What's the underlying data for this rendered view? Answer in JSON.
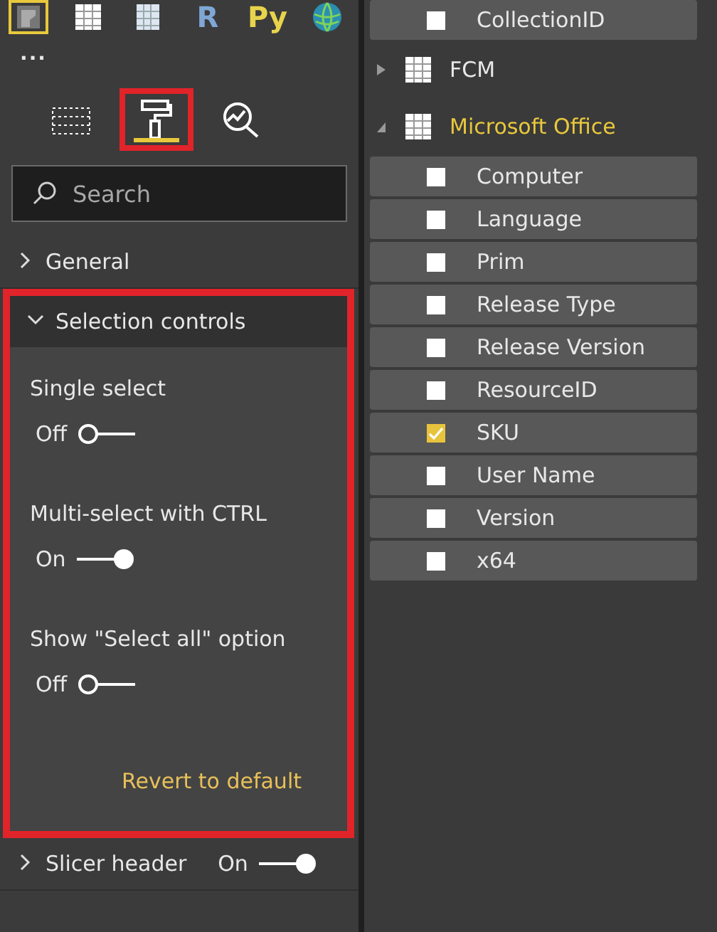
{
  "visual_icons": [
    {
      "kind": "slicer",
      "selected": true
    },
    {
      "kind": "table",
      "selected": false
    },
    {
      "kind": "matrix",
      "selected": false
    },
    {
      "kind": "r",
      "label": "R",
      "selected": false
    },
    {
      "kind": "python",
      "label": "Py",
      "selected": false
    },
    {
      "kind": "globe",
      "selected": false
    }
  ],
  "more_label": "...",
  "pane_tabs": [
    {
      "kind": "fields",
      "selected": false,
      "highlighted": false
    },
    {
      "kind": "format",
      "selected": true,
      "highlighted": true
    },
    {
      "kind": "analytics",
      "selected": false,
      "highlighted": false
    }
  ],
  "search": {
    "placeholder": "Search"
  },
  "sections": [
    {
      "title": "General",
      "expanded": false,
      "highlighted": false
    },
    {
      "title": "Selection controls",
      "expanded": true,
      "highlighted": true,
      "settings": [
        {
          "label": "Single select",
          "on": false,
          "reading": "Off"
        },
        {
          "label": "Multi-select with CTRL",
          "on": true,
          "reading": "On"
        },
        {
          "label": "Show \"Select all\" option",
          "on": false,
          "reading": "Off"
        }
      ],
      "link": "Revert to default"
    },
    {
      "title": "Slicer header",
      "expanded": false,
      "highlighted": false,
      "toggle": {
        "on": true,
        "reading": "On"
      }
    }
  ],
  "fields": [
    {
      "kind": "field",
      "name": "CollectionID",
      "checked": false
    },
    {
      "kind": "table",
      "name": "FCM",
      "expanded": false,
      "selected": false
    },
    {
      "kind": "table",
      "name": "Microsoft Office",
      "expanded": true,
      "selected": true,
      "children": [
        {
          "kind": "field",
          "name": "Computer",
          "checked": false
        },
        {
          "kind": "field",
          "name": "Language",
          "checked": false
        },
        {
          "kind": "field",
          "name": "Prim",
          "checked": false
        },
        {
          "kind": "field",
          "name": "Release Type",
          "checked": false
        },
        {
          "kind": "field",
          "name": "Release Version",
          "checked": false
        },
        {
          "kind": "field",
          "name": "ResourceID",
          "checked": false
        },
        {
          "kind": "field",
          "name": "SKU",
          "checked": true
        },
        {
          "kind": "field",
          "name": "User Name",
          "checked": false
        },
        {
          "kind": "field",
          "name": "Version",
          "checked": false
        },
        {
          "kind": "field",
          "name": "x64",
          "checked": false
        }
      ]
    }
  ]
}
